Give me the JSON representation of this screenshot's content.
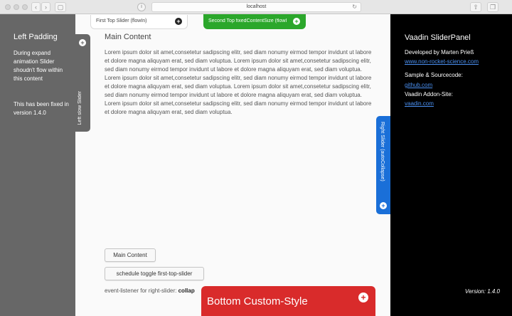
{
  "browser": {
    "url": "localhost",
    "back_icon": "chevron-left-icon",
    "forward_icon": "chevron-right-icon"
  },
  "left_panel": {
    "title": "Left Padding",
    "text1": "During expand animation Slider shoudn't flow within this content",
    "text2": "This has been fixed in version 1.4.0"
  },
  "left_slider": {
    "label": "Left slow Slider",
    "toggle": "+"
  },
  "top_slider_1": {
    "label": "First Top Slider (flowIn)",
    "toggle": "+"
  },
  "top_slider_2": {
    "label": "Second Top fixedContentSize (flowI",
    "toggle": "+",
    "color": "#2ba72b"
  },
  "main": {
    "title": "Main Content",
    "lorem": "Lorem ipsum dolor sit amet,consetetur sadipscing elitr, sed diam nonumy eirmod tempor invidunt ut labore et dolore magna aliquyam erat, sed diam voluptua. Lorem ipsum dolor sit amet,consetetur sadipscing elitr, sed diam nonumy eirmod tempor invidunt ut labore et dolore magna aliquyam erat, sed diam voluptua. Lorem ipsum dolor sit amet,consetetur sadipscing elitr, sed diam nonumy eirmod tempor invidunt ut labore et dolore magna aliquyam erat, sed diam voluptua. Lorem ipsum dolor sit amet,consetetur sadipscing elitr, sed diam nonumy eirmod tempor invidunt ut labore et dolore magna aliquyam erat, sed diam voluptua. Lorem ipsum dolor sit amet,consetetur sadipscing elitr, sed diam nonumy eirmod tempor invidunt ut labore et dolore magna aliquyam erat, sed diam voluptua.",
    "button_main": "Main Content",
    "button_schedule": "schedule toggle first-top-slider",
    "listener_label": "event-listener for right-slider:",
    "listener_value": "collap"
  },
  "right_slider": {
    "label": "Right Slider (autoCollapse)",
    "toggle": "+",
    "color": "#1a6fd8"
  },
  "bottom_slider": {
    "label": "Bottom Custom-Style",
    "toggle": "+",
    "color": "#d92b2b"
  },
  "right_panel": {
    "title": "Vaadin SliderPanel",
    "developed_by": "Developed by Marten Prieß",
    "link_site": "www.non-rocket-science.com",
    "sample_label": "Sample & Sourcecode:",
    "link_github": "github.com",
    "addon_label": "Vaadin Addon-Site:",
    "link_vaadin": "vaadin.com",
    "version": "Version: 1.4.0"
  }
}
